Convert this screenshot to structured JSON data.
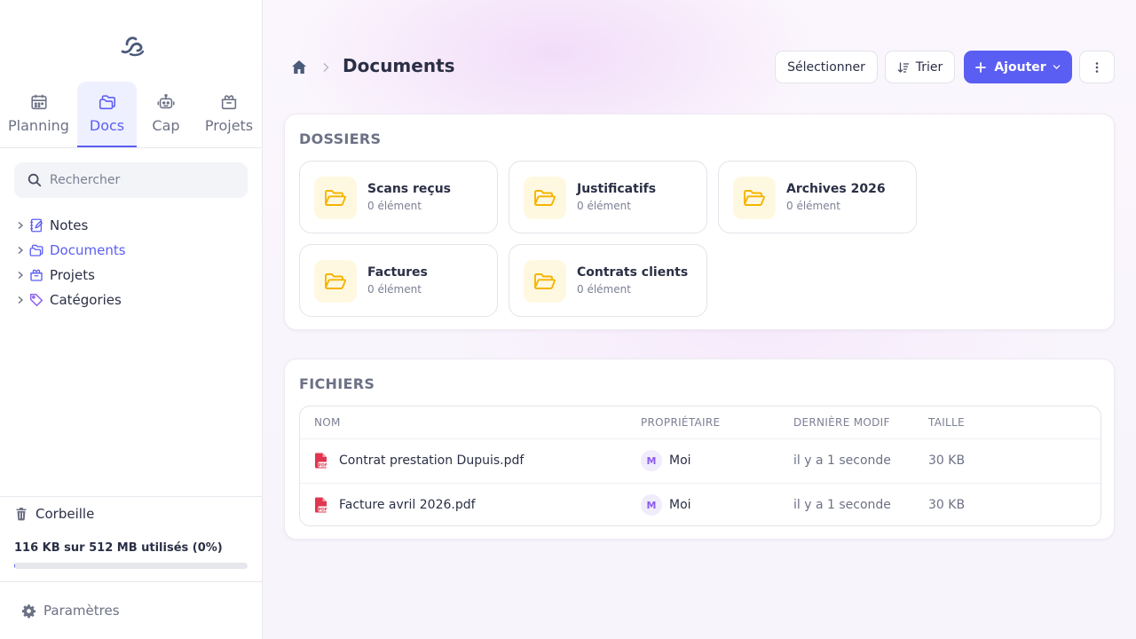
{
  "sidebar": {
    "apps": [
      {
        "label": "Planning",
        "icon": "calendar-icon"
      },
      {
        "label": "Docs",
        "icon": "folders-icon",
        "active": true
      },
      {
        "label": "Cap",
        "icon": "robot-icon"
      },
      {
        "label": "Projets",
        "icon": "box-icon"
      }
    ],
    "search_placeholder": "Rechercher",
    "tree": [
      {
        "label": "Notes",
        "icon": "notebook-icon"
      },
      {
        "label": "Documents",
        "icon": "folders-icon",
        "active": true
      },
      {
        "label": "Projets",
        "icon": "box-icon"
      },
      {
        "label": "Catégories",
        "icon": "tag-icon"
      }
    ],
    "trash_label": "Corbeille",
    "storage_text": "116 KB sur 512 MB utilisés (0%)",
    "storage_percent": 0.2,
    "settings_label": "Paramètres"
  },
  "header": {
    "title": "Documents",
    "select_label": "Sélectionner",
    "sort_label": "Trier",
    "add_label": "Ajouter"
  },
  "folders_section": {
    "title": "DOSSIERS",
    "items": [
      {
        "name": "Scans reçus",
        "count": "0 élément"
      },
      {
        "name": "Justificatifs",
        "count": "0 élément"
      },
      {
        "name": "Archives 2026",
        "count": "0 élément"
      },
      {
        "name": "Factures",
        "count": "0 élément"
      },
      {
        "name": "Contrats clients",
        "count": "0 élément"
      }
    ]
  },
  "files_section": {
    "title": "FICHIERS",
    "columns": {
      "name": "NOM",
      "owner": "PROPRIÉTAIRE",
      "modified": "DERNIÈRE MODIF",
      "size": "TAILLE"
    },
    "rows": [
      {
        "name": "Contrat prestation Dupuis.pdf",
        "owner_initial": "M",
        "owner": "Moi",
        "modified": "il y a 1 seconde",
        "size": "30 KB"
      },
      {
        "name": "Facture avril 2026.pdf",
        "owner_initial": "M",
        "owner": "Moi",
        "modified": "il y a 1 seconde",
        "size": "30 KB"
      }
    ]
  },
  "colors": {
    "accent": "#5b5ef2",
    "folder": "#f5b400",
    "pdf": "#e0364f"
  }
}
